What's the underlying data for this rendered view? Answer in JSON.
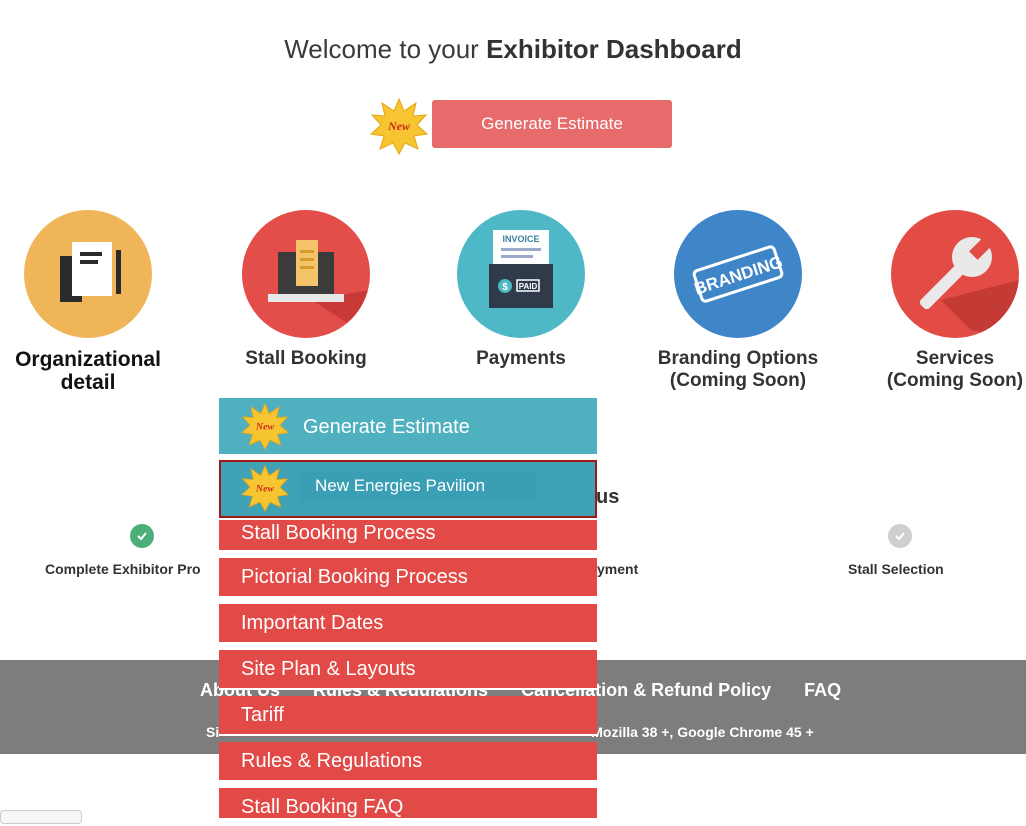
{
  "header": {
    "welcome_prefix": "Welcome to your ",
    "welcome_strong": "Exhibitor Dashboard",
    "new_badge": "New",
    "generate_estimate": "Generate Estimate"
  },
  "cards": [
    {
      "label_line1": "Organizational",
      "label_line2": "detail",
      "icon": "document-pen-icon",
      "color": "#f0b558"
    },
    {
      "label_line1": "Stall Booking",
      "label_line2": "",
      "icon": "laptop-icon",
      "color": "#e34d4a"
    },
    {
      "label_line1": "Payments",
      "label_line2": "",
      "icon": "invoice-paid-icon",
      "color": "#4fb8c6"
    },
    {
      "label_line1": "Branding Options",
      "label_line2": "(Coming Soon)",
      "icon": "branding-stamp-icon",
      "color": "#3f86c8"
    },
    {
      "label_line1": "Services",
      "label_line2": "(Coming Soon)",
      "icon": "wrench-icon",
      "color": "#e24c45"
    }
  ],
  "status": {
    "heading_tail": "us",
    "steps": [
      {
        "label": "Complete Exhibitor Pro",
        "done": true
      },
      {
        "label": "yment",
        "done": false
      },
      {
        "label": "Stall Selection",
        "done": false
      }
    ]
  },
  "menu": {
    "items": [
      {
        "label": "Generate Estimate",
        "badge": "New",
        "style": "teal"
      },
      {
        "label": "New Energies Pavilion",
        "badge": "New",
        "style": "teal-selected"
      },
      {
        "label": "Stall Booking Process",
        "style": "red"
      },
      {
        "label": "Pictorial Booking Process",
        "style": "red"
      },
      {
        "label": "Important Dates",
        "style": "red"
      },
      {
        "label": "Site Plan & Layouts",
        "style": "red"
      },
      {
        "label": "Tariff",
        "style": "red"
      },
      {
        "label": "Rules & Regulations",
        "style": "red"
      },
      {
        "label": "Stall Booking FAQ",
        "style": "red"
      }
    ]
  },
  "footer": {
    "links": [
      "About Us",
      "Rules & Regulations",
      "Cancellation & Refund Policy",
      "FAQ"
    ],
    "browser_note_start": "Si",
    "browser_note_end": "Mozilla 38 +, Google Chrome 45 +"
  },
  "colors": {
    "accent_red": "#e14a47",
    "teal": "#4fb0c0",
    "button": "#e86b6b",
    "footer": "#7d7d7d",
    "check_green": "#4caf7a"
  }
}
